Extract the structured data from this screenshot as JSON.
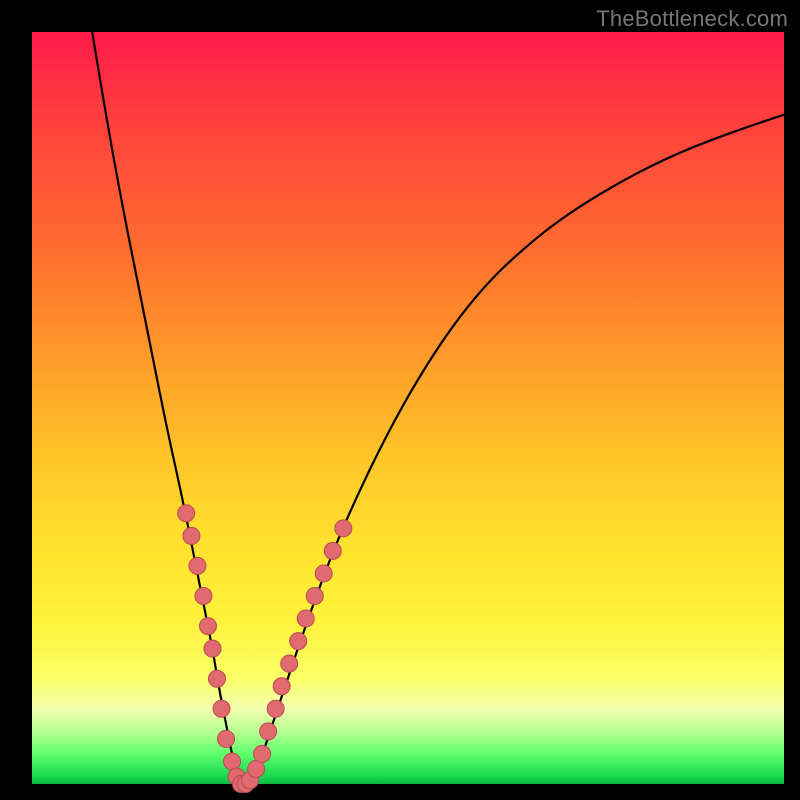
{
  "watermark": "TheBottleneck.com",
  "chart_data": {
    "type": "line",
    "title": "",
    "xlabel": "",
    "ylabel": "",
    "xlim": [
      0,
      100
    ],
    "ylim": [
      0,
      100
    ],
    "grid": false,
    "legend": false,
    "series": [
      {
        "name": "curve",
        "x": [
          8,
          10,
          12,
          14,
          16,
          18,
          20,
          22,
          23,
          24,
          25,
          26,
          27,
          28,
          29,
          30,
          32,
          36,
          40,
          44,
          48,
          52,
          56,
          60,
          64,
          70,
          78,
          86,
          94,
          100
        ],
        "y": [
          100,
          88,
          77,
          67,
          57,
          47,
          38,
          28,
          23,
          18,
          12,
          7,
          2,
          0,
          0,
          2,
          8,
          20,
          31,
          40,
          48,
          55,
          61,
          66,
          70,
          75,
          80,
          84,
          87,
          89
        ]
      }
    ],
    "markers": {
      "name": "highlight-dots",
      "points": [
        {
          "x": 20.5,
          "y": 36
        },
        {
          "x": 21.2,
          "y": 33
        },
        {
          "x": 22.0,
          "y": 29
        },
        {
          "x": 22.8,
          "y": 25
        },
        {
          "x": 23.4,
          "y": 21
        },
        {
          "x": 24.0,
          "y": 18
        },
        {
          "x": 24.6,
          "y": 14
        },
        {
          "x": 25.2,
          "y": 10
        },
        {
          "x": 25.8,
          "y": 6
        },
        {
          "x": 26.6,
          "y": 3
        },
        {
          "x": 27.2,
          "y": 1
        },
        {
          "x": 27.8,
          "y": 0
        },
        {
          "x": 28.4,
          "y": 0
        },
        {
          "x": 29.0,
          "y": 0.5
        },
        {
          "x": 29.8,
          "y": 2
        },
        {
          "x": 30.6,
          "y": 4
        },
        {
          "x": 31.4,
          "y": 7
        },
        {
          "x": 32.4,
          "y": 10
        },
        {
          "x": 33.2,
          "y": 13
        },
        {
          "x": 34.2,
          "y": 16
        },
        {
          "x": 35.4,
          "y": 19
        },
        {
          "x": 36.4,
          "y": 22
        },
        {
          "x": 37.6,
          "y": 25
        },
        {
          "x": 38.8,
          "y": 28
        },
        {
          "x": 40.0,
          "y": 31
        },
        {
          "x": 41.4,
          "y": 34
        }
      ]
    },
    "notes": "V-shaped bottleneck curve over rainbow background; minimum near x≈28 at y≈0. Dots cluster on both arms near the bottom (roughly y ≤ 36)."
  }
}
